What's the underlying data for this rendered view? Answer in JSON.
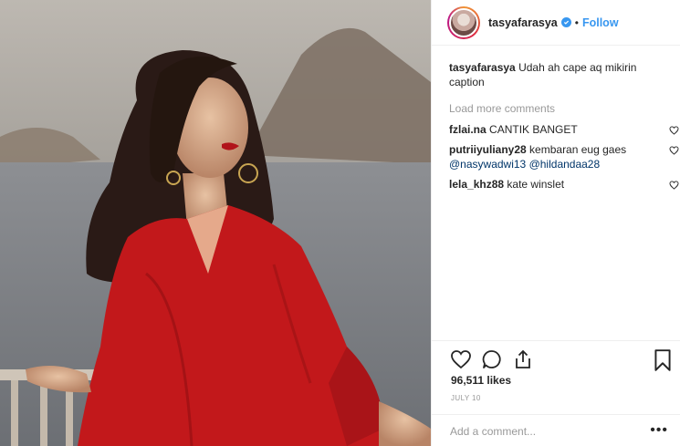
{
  "post": {
    "username": "tasyafarasya",
    "follow_label": "Follow",
    "separator": "•",
    "caption": {
      "user": "tasyafarasya",
      "text": "Udah ah cape aq mikirin caption"
    },
    "load_more": "Load more comments",
    "comments": [
      {
        "user": "fzlai.na",
        "text": "CANTIK BANGET"
      },
      {
        "user": "putriiyuliany28",
        "text": "kembaran eug gaes",
        "mentions": [
          "@nasywadwi13",
          "@hildandaa28"
        ]
      },
      {
        "user": "lela_khz88",
        "text": "kate winslet"
      }
    ],
    "likes": "96,511 likes",
    "date": "JULY 10",
    "add_comment_placeholder": "Add a comment...",
    "more_label": "•••"
  },
  "icons": {
    "like": "heart-icon",
    "comment": "comment-bubble-icon",
    "share": "share-icon",
    "save": "bookmark-icon",
    "verified": "verified-badge-icon",
    "comment_like": "small-heart-icon"
  },
  "colors": {
    "link_blue": "#3897f0",
    "mention_blue": "#003569",
    "muted": "#999999",
    "text": "#262626",
    "dress_red": "#c2181b"
  }
}
